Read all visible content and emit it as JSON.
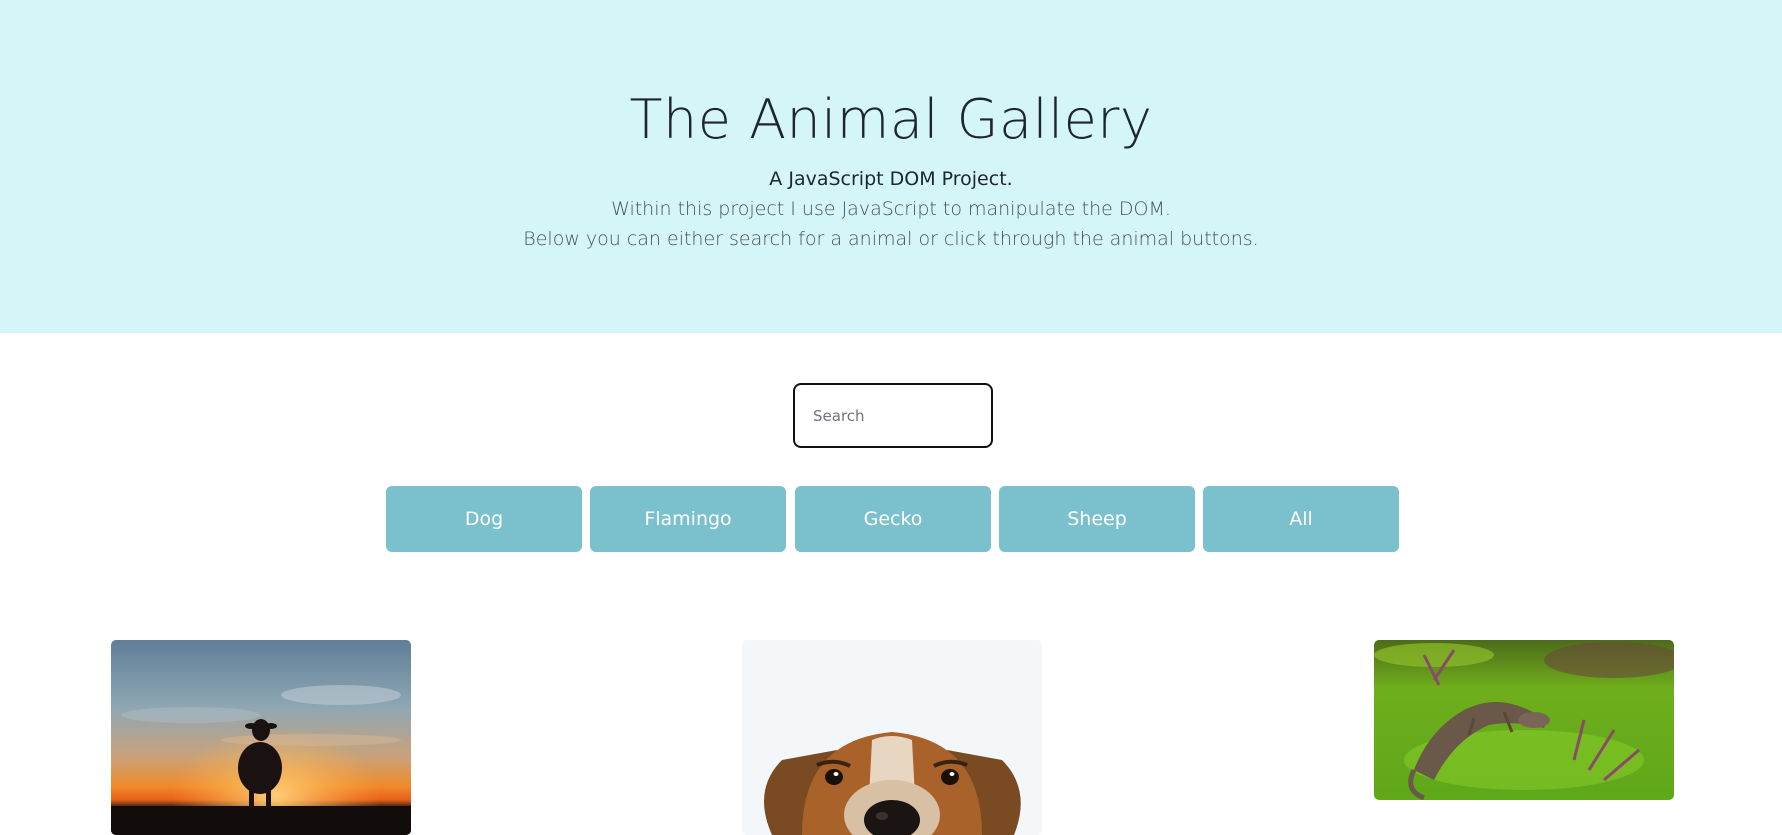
{
  "hero": {
    "title": "The Animal Gallery",
    "subtitle": "A JavaScript DOM Project.",
    "line1": "Within this project I use JavaScript to manipulate the DOM.",
    "line2": "Below you can either search for a animal or click through the animal buttons.",
    "background": "#d4f6f9"
  },
  "search": {
    "placeholder": "Search",
    "value": ""
  },
  "filters": {
    "accent": "#7ac1cd",
    "buttons": [
      {
        "label": "Dog"
      },
      {
        "label": "Flamingo"
      },
      {
        "label": "Gecko"
      },
      {
        "label": "Sheep"
      },
      {
        "label": "All"
      }
    ]
  },
  "gallery": {
    "images": [
      {
        "animal": "sheep"
      },
      {
        "animal": "dog"
      },
      {
        "animal": "gecko"
      }
    ]
  }
}
